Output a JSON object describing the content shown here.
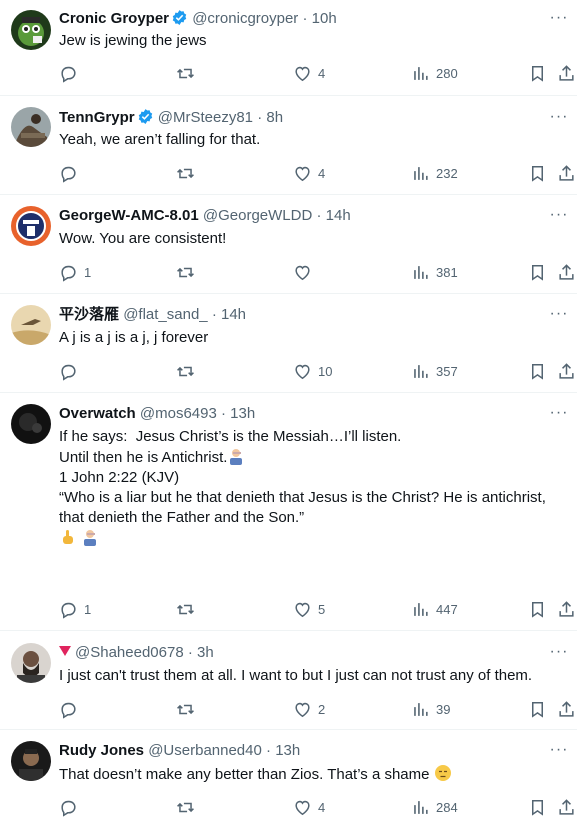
{
  "colors": {
    "text": "#0f1419",
    "muted": "#536471",
    "verified": "#1d9bf0",
    "divider": "#eff3f4"
  },
  "tweets": [
    {
      "name": "Cronic Groyper",
      "verified": true,
      "handle": "@cronicgroyper",
      "time": "10h",
      "lines": [
        "Jew is jewing the jews"
      ],
      "likes": "4",
      "views": "280",
      "replies": "",
      "reposts": ""
    },
    {
      "name": "TennGrypr",
      "verified": true,
      "handle": "@MrSteezy81",
      "time": "8h",
      "lines": [
        "Yeah, we aren’t falling for that."
      ],
      "likes": "4",
      "views": "232",
      "replies": "",
      "reposts": ""
    },
    {
      "name": "GeorgeW-AMC-8.01",
      "verified": false,
      "handle": "@GeorgeWLDD",
      "time": "14h",
      "lines": [
        "Wow. You are consistent!"
      ],
      "likes": "",
      "views": "381",
      "replies": "1",
      "reposts": ""
    },
    {
      "name": "平沙落雁",
      "verified": false,
      "handle": "@flat_sand_",
      "time": "14h",
      "lines": [
        "A j is a j is a j, j forever"
      ],
      "likes": "10",
      "views": "357",
      "replies": "",
      "reposts": ""
    },
    {
      "name": "Overwatch",
      "verified": false,
      "handle": "@mos6493",
      "time": "13h",
      "lines": [
        "If he says:  Jesus Christ’s is the Messiah…I’ll listen.",
        "Until then he is Antichrist.",
        "",
        "1 John 2:22 (KJV)",
        "“Who is a liar but he that denieth that Jesus is the Christ? He is antichrist,",
        "that denieth the Father and the Son.”",
        "",
        ""
      ],
      "likes": "5",
      "views": "447",
      "replies": "1",
      "reposts": ""
    },
    {
      "name": "",
      "verified": false,
      "handle": "@Shaheed0678",
      "time": "3h",
      "lines": [
        "I just can't trust them at all. I want to but I just can not trust any of them."
      ],
      "likes": "2",
      "views": "39",
      "replies": "",
      "reposts": ""
    },
    {
      "name": "Rudy Jones",
      "verified": false,
      "handle": "@Userbanned40",
      "time": "13h",
      "lines": [
        "That doesn’t make any better than Zios. That’s a shame"
      ],
      "likes": "4",
      "views": "284",
      "replies": "",
      "reposts": ""
    }
  ],
  "ui": {
    "sep": "·",
    "more": "···"
  }
}
